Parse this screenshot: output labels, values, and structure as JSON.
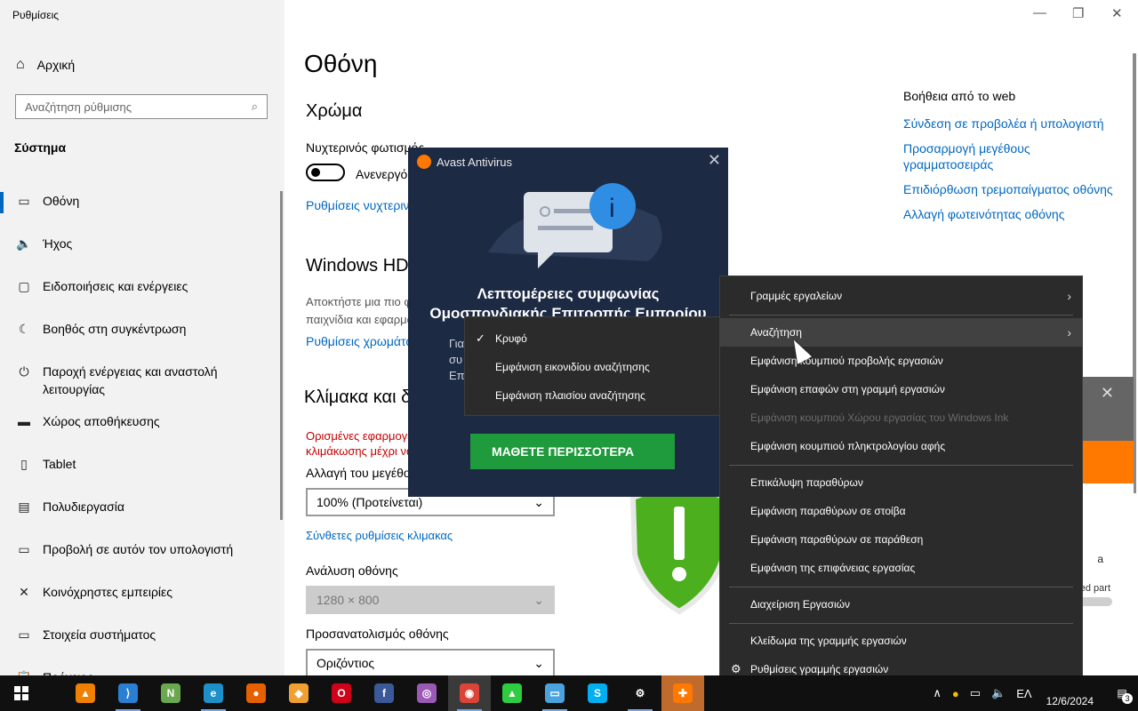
{
  "app": {
    "title": "Ρυθμίσεις"
  },
  "sidebar": {
    "home": "Αρχική",
    "search_placeholder": "Αναζήτηση ρύθμισης",
    "section": "Σύστημα",
    "items": [
      {
        "label": "Οθόνη",
        "icon": "monitor-icon",
        "glyph": "▭"
      },
      {
        "label": "Ήχος",
        "icon": "speaker-icon",
        "glyph": "🔈"
      },
      {
        "label": "Ειδοποιήσεις και ενέργειες",
        "icon": "notification-icon",
        "glyph": "▢"
      },
      {
        "label": "Βοηθός στη συγκέντρωση",
        "icon": "moon-icon",
        "glyph": "☾"
      },
      {
        "label": "Παροχή ενέργειας και αναστολή λειτουργίας",
        "icon": "power-icon",
        "glyph": "⏻"
      },
      {
        "label": "Χώρος αποθήκευσης",
        "icon": "storage-icon",
        "glyph": "▬"
      },
      {
        "label": "Tablet",
        "icon": "tablet-icon",
        "glyph": "▯"
      },
      {
        "label": "Πολυδιεργασία",
        "icon": "multitasking-icon",
        "glyph": "▤"
      },
      {
        "label": "Προβολή σε αυτόν τον υπολογιστή",
        "icon": "project-icon",
        "glyph": "▭"
      },
      {
        "label": "Κοινόχρηστες εμπειρίες",
        "icon": "share-icon",
        "glyph": "✕"
      },
      {
        "label": "Στοιχεία συστήματος",
        "icon": "components-icon",
        "glyph": "▭"
      },
      {
        "label": "Πρόχειρο",
        "icon": "clipboard-icon",
        "glyph": "📋"
      }
    ]
  },
  "main": {
    "title": "Οθόνη",
    "color_heading": "Χρώμα",
    "night_light_label": "Νυχτερινός φωτισμός",
    "toggle_state": "Ανενεργό",
    "night_light_link": "Ρυθμίσεις νυχτερινού φωτισμού",
    "hdr_heading": "Windows HD Color",
    "hdr_text_1": "Αποκτήστε μια πιο φωτεινή και ζωντανή εικόνα σε βίντεο HDR,",
    "hdr_text_2": "παιχνίδια και εφαρμογές.",
    "hdr_link": "Ρυθμίσεις χρωμάτων Windows HD",
    "scale_heading": "Κλίμακα και διάταξη",
    "scale_warn_1": "Ορισμένες εφαρμογές δεν θα ανταποκριθούν στις αλλαγές",
    "scale_warn_2": "κλιμάκωσης μέχρι να τις κλείσετε.",
    "scale_label": "Αλλαγή του μεγέθους κειμένου, εφαρμογών και άλλων στοιχείων",
    "scale_value": "100% (Προτείνεται)",
    "advanced_scale_link": "Σύνθετες ρυθμίσεις κλιμακας",
    "resolution_label": "Ανάλυση οθόνης",
    "resolution_value": "1280 × 800",
    "orientation_label": "Προσανατολισμός οθόνης",
    "orientation_value": "Οριζόντιος"
  },
  "help": {
    "title": "Βοήθεια από το web",
    "links": [
      "Σύνδεση σε προβολέα ή υπολογιστή",
      "Προσαρμογή μεγέθους γραμματοσειράς",
      "Επιδιόρθωση τρεμοπαίγματος οθόνης",
      "Αλλαγή φωτεινότητας οθόνης"
    ]
  },
  "avast": {
    "title": "Avast Antivirus",
    "headline_1": "Λεπτομέρειες συμφωνίας",
    "headline_2": "Ομοσπονδιακής Επιτροπής Εμπορίου",
    "body_1": "Για",
    "body_2": "συ",
    "body_3": "Επ",
    "button": "ΜΑΘΕΤΕ ΠΕΡΙΣΣΟΤΕΡΑ",
    "side_text": "a",
    "side_text_2": "ed part"
  },
  "context_menu": {
    "items": [
      {
        "label": "Γραμμές εργαλείων",
        "submenu": true
      },
      {
        "label": "Αναζήτηση",
        "submenu": true
      },
      {
        "label": "Εμφάνιση κουμπιού προβολής εργασιών"
      },
      {
        "label": "Εμφάνιση επαφών στη γραμμή εργασιών"
      },
      {
        "label": "Εμφάνιση κουμπιού Χώρου εργασίας του Windows Ink",
        "disabled": true
      },
      {
        "label": "Εμφάνιση κουμπιού πληκτρολογίου αφής"
      },
      {
        "label": "Επικάλυψη παραθύρων"
      },
      {
        "label": "Εμφάνιση παραθύρων σε στοίβα"
      },
      {
        "label": "Εμφάνιση παραθύρων σε παράθεση"
      },
      {
        "label": "Εμφάνιση της επιφάνειας εργασίας"
      },
      {
        "label": "Διαχείριση Εργασιών"
      },
      {
        "label": "Κλείδωμα της γραμμής εργασιών"
      },
      {
        "label": "Ρυθμίσεις γραμμής εργασιών"
      }
    ]
  },
  "search_submenu": {
    "items": [
      "Κρυφό",
      "Εμφάνιση εικονιδίου αναζήτησης",
      "Εμφάνιση πλαισίου αναζήτησης"
    ],
    "checked": "Κρυφό"
  },
  "taskbar": {
    "apps": [
      {
        "name": "vlc-icon",
        "color": "#f08000",
        "glyph": "▲"
      },
      {
        "name": "vscode-icon",
        "color": "#2a7fd4",
        "glyph": "⟩"
      },
      {
        "name": "notepadpp-icon",
        "color": "#6aa84f",
        "glyph": "N"
      },
      {
        "name": "edge-icon",
        "color": "#1e90c8",
        "glyph": "e"
      },
      {
        "name": "firefox-icon",
        "color": "#e66000",
        "glyph": "●"
      },
      {
        "name": "brave-icon",
        "color": "#f0a030",
        "glyph": "◆"
      },
      {
        "name": "opera-icon",
        "color": "#d0021b",
        "glyph": "O"
      },
      {
        "name": "facebook-icon",
        "color": "#3b5998",
        "glyph": "f"
      },
      {
        "name": "colorwheel-icon",
        "color": "#9b59b6",
        "glyph": "◎"
      },
      {
        "name": "chrome-icon",
        "color": "#db4437",
        "glyph": "◉"
      },
      {
        "name": "affinity-icon",
        "color": "#2ecc40",
        "glyph": "▲"
      },
      {
        "name": "monitor-app-icon",
        "color": "#4aa3df",
        "glyph": "▭"
      },
      {
        "name": "skype-icon",
        "color": "#00aff0",
        "glyph": "S"
      },
      {
        "name": "settings-gear-icon",
        "color": "#101010",
        "glyph": "⚙"
      },
      {
        "name": "avast-icon",
        "color": "#ff7800",
        "glyph": "✚"
      }
    ],
    "date": "12/6/2024",
    "notification_count": "3"
  }
}
